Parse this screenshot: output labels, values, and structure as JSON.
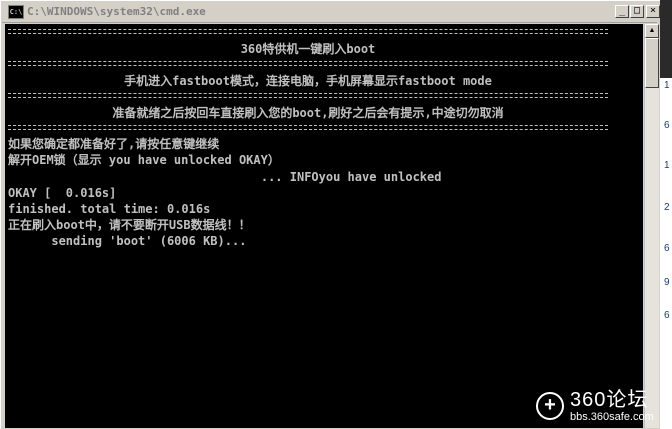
{
  "window": {
    "icon_label": "C:\\",
    "title": "C:\\WINDOWS\\system32\\cmd.exe",
    "minimize_glyph": "_",
    "maximize_glyph": "□",
    "close_glyph": "×"
  },
  "console": {
    "title_line": "360特供机一键刷入boot",
    "instruction_line": "手机进入fastboot模式，连接电脑，手机屏幕显示fastboot mode",
    "ready_line": "准备就绪之后按回车直接刷入您的boot,刷好之后会有提示,中途切勿取消",
    "lines": [
      "如果您确定都准备好了,请按任意键继续",
      "解开OEM锁（显示 you have unlocked OKAY）",
      "                                   ... INFOyou have unlocked",
      "OKAY [  0.016s]",
      "finished. total time: 0.016s",
      "正在刷入boot中，请不要断开USB数据线！！",
      "      sending 'boot' (6006 KB)..."
    ]
  },
  "scrollbar": {
    "up_glyph": "▲"
  },
  "background_window": {
    "digits": [
      "1",
      "6",
      "1",
      "2",
      "6",
      "9",
      "6"
    ]
  },
  "watermark": {
    "name": "360论坛",
    "url": "bbs.360safe.com",
    "logo_glyph": "+"
  }
}
